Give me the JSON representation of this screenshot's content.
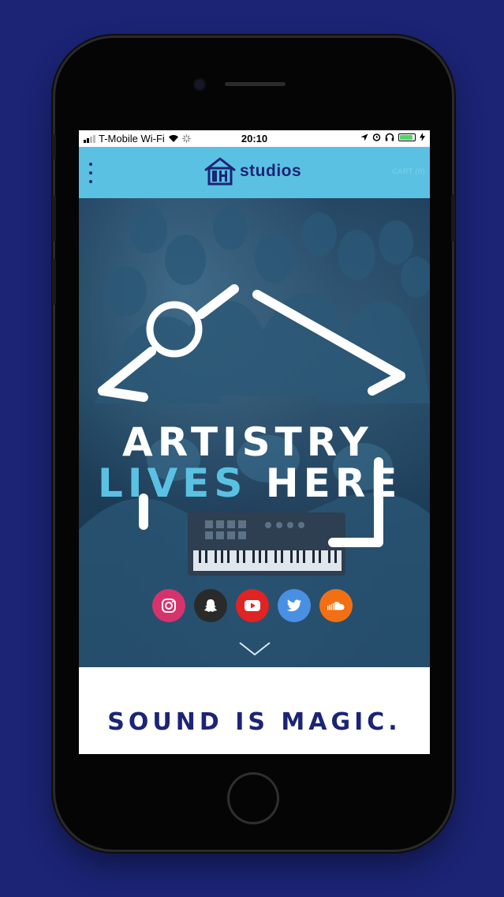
{
  "status_bar": {
    "carrier": "T-Mobile Wi-Fi",
    "time": "20:10",
    "battery_level": 0.9
  },
  "header": {
    "logo_text": "studios",
    "cart_label": "CART (0)"
  },
  "hero": {
    "headline_line1": "ARTISTRY",
    "headline_word_accent": "LIVES",
    "headline_word_plain": "HERE",
    "social_links": [
      {
        "name": "instagram",
        "color": "#d6336c"
      },
      {
        "name": "snapchat",
        "color": "#2a2a2a"
      },
      {
        "name": "youtube",
        "color": "#e02424"
      },
      {
        "name": "twitter",
        "color": "#4a90e2"
      },
      {
        "name": "soundcloud",
        "color": "#f26f14"
      }
    ]
  },
  "section": {
    "tagline": "SOUND IS MAGIC."
  },
  "colors": {
    "page_bg": "#1b2475",
    "header_bg": "#5bc1e3",
    "brand_navy": "#1b2475",
    "accent_light_blue": "#5bc1e3"
  }
}
